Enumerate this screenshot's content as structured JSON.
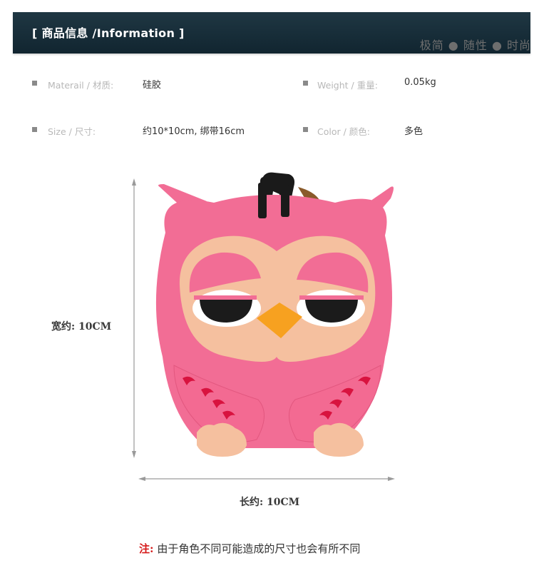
{
  "header": {
    "title": "[ 商品信息 /Information ]",
    "motto": "极简 ● 随性 ● 时尚"
  },
  "specs": {
    "material": {
      "label": "Materail / 材质:",
      "value": "硅胶"
    },
    "weight": {
      "label": "Weight / 重量:",
      "value": "0.05kg"
    },
    "size": {
      "label": "Size / 尺寸:",
      "value": "约10*10cm, 绑带16cm"
    },
    "color": {
      "label": "Color / 颜色:",
      "value": "多色"
    }
  },
  "dimensions": {
    "width_label": "宽约: 10CM",
    "length_label": "长约: 10CM"
  },
  "note": {
    "prefix": "注:",
    "text": "由于角色不同可能造成的尺寸也会有所不同"
  },
  "colors": {
    "header_bg": "#132a35",
    "owl_pink": "#f26d95",
    "owl_face": "#f5c09f",
    "beak": "#f7a120",
    "note_red": "#d61a1a"
  },
  "product_image": "pink owl silicone luggage tag"
}
